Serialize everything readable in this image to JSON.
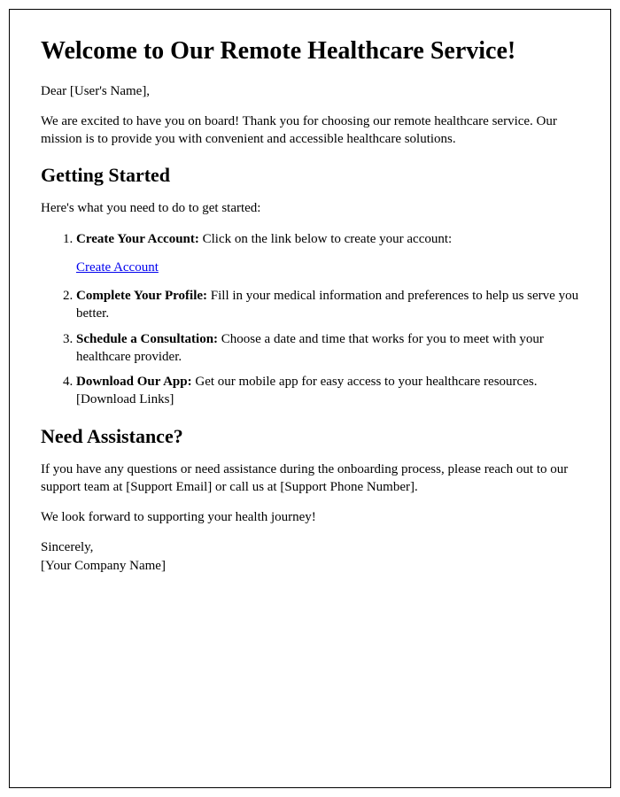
{
  "title": "Welcome to Our Remote Healthcare Service!",
  "greeting": "Dear [User's Name],",
  "intro": "We are excited to have you on board! Thank you for choosing our remote healthcare service. Our mission is to provide you with convenient and accessible healthcare solutions.",
  "getting_started": {
    "heading": "Getting Started",
    "intro": "Here's what you need to do to get started:",
    "steps": [
      {
        "label": "Create Your Account:",
        "text": " Click on the link below to create your account:",
        "link_text": "Create Account"
      },
      {
        "label": "Complete Your Profile:",
        "text": " Fill in your medical information and preferences to help us serve you better."
      },
      {
        "label": "Schedule a Consultation:",
        "text": " Choose a date and time that works for you to meet with your healthcare provider."
      },
      {
        "label": "Download Our App:",
        "text": " Get our mobile app for easy access to your healthcare resources. [Download Links]"
      }
    ]
  },
  "assistance": {
    "heading": "Need Assistance?",
    "text": "If you have any questions or need assistance during the onboarding process, please reach out to our support team at [Support Email] or call us at [Support Phone Number]."
  },
  "closing": "We look forward to supporting your health journey!",
  "signoff_line1": "Sincerely,",
  "signoff_line2": "[Your Company Name]"
}
